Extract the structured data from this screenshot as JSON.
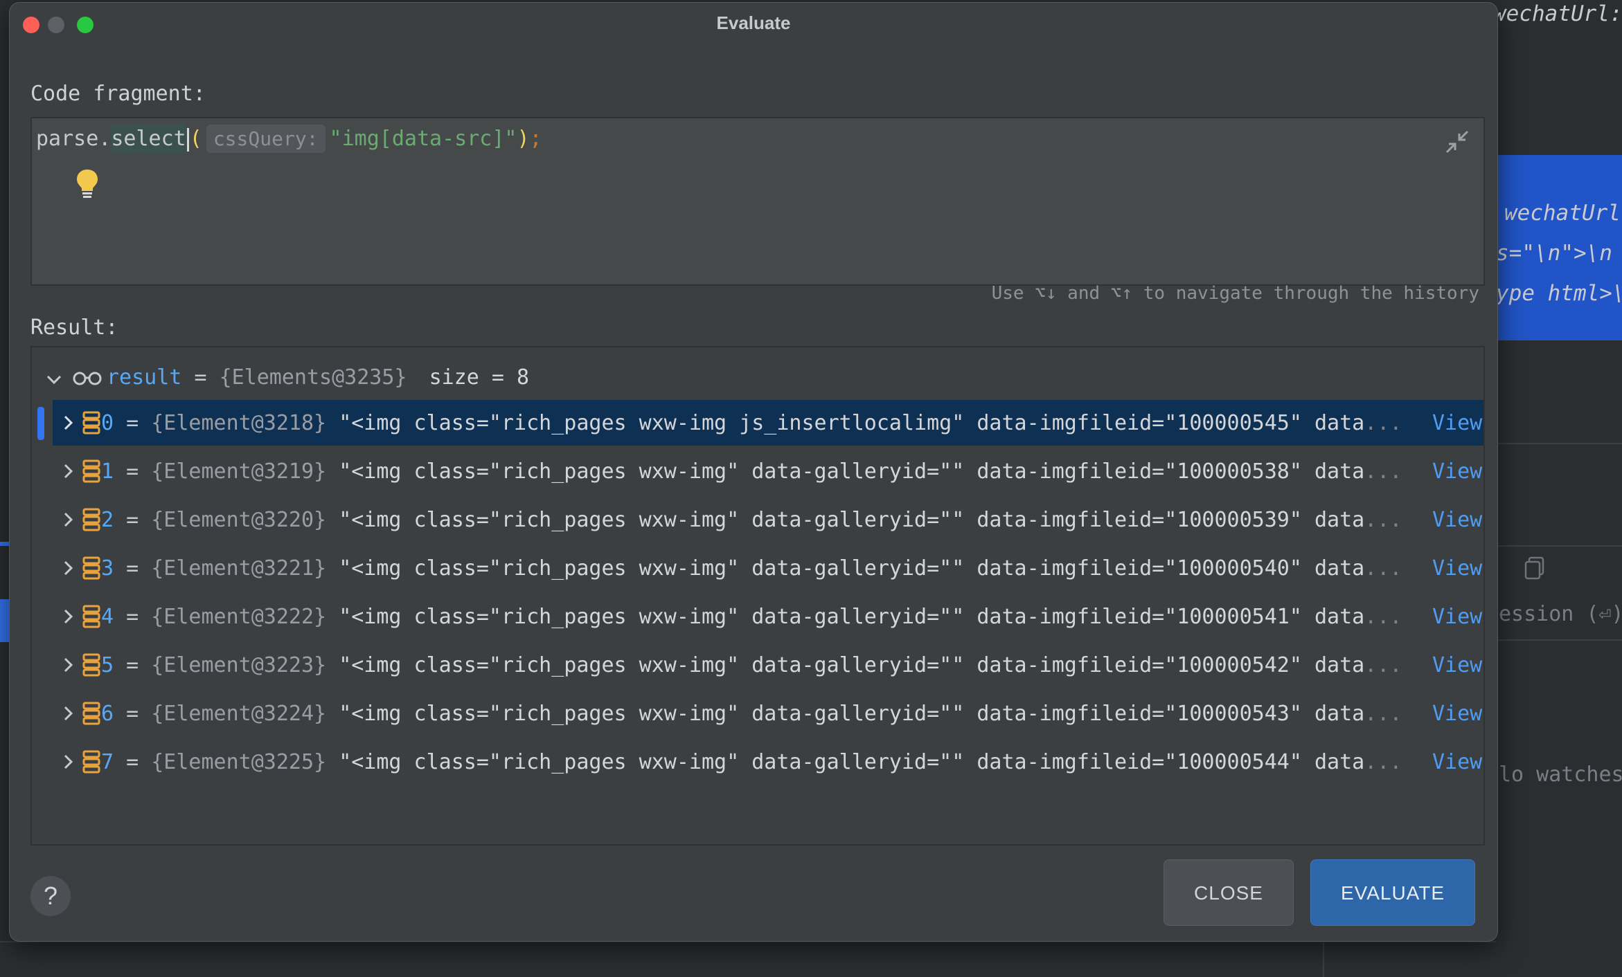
{
  "background": {
    "right_lines": [
      "wechatUrl:",
      "wechatUrl",
      "s=\"\\n\">\\n",
      "ype html>\\"
    ],
    "session_label": "ession (⏎)",
    "watches_label": "lo watches"
  },
  "dialog": {
    "title": "Evaluate",
    "code_fragment_label": "Code fragment:",
    "code": {
      "receiver": "parse.",
      "method": "select",
      "open_paren": "(",
      "param_hint": "cssQuery:",
      "argument": "\"img[data-src]\"",
      "close_paren": ")",
      "semicolon": ";"
    },
    "history_hint": "Use ⌥↓ and ⌥↑ to navigate through the history",
    "result_label": "Result:",
    "result": {
      "name": "result",
      "ref": "{Elements@3235}",
      "size_text": "size = 8",
      "children": [
        {
          "index": "0",
          "ref": "{Element@3218}",
          "value": "\"<img class=\"rich_pages wxw-img js_insertlocalimg\" data-imgfileid=\"100000545\" data",
          "link": "View"
        },
        {
          "index": "1",
          "ref": "{Element@3219}",
          "value": "\"<img class=\"rich_pages wxw-img\" data-galleryid=\"\" data-imgfileid=\"100000538\" data",
          "link": "View"
        },
        {
          "index": "2",
          "ref": "{Element@3220}",
          "value": "\"<img class=\"rich_pages wxw-img\" data-galleryid=\"\" data-imgfileid=\"100000539\" data",
          "link": "View"
        },
        {
          "index": "3",
          "ref": "{Element@3221}",
          "value": "\"<img class=\"rich_pages wxw-img\" data-galleryid=\"\" data-imgfileid=\"100000540\" data",
          "link": "View"
        },
        {
          "index": "4",
          "ref": "{Element@3222}",
          "value": "\"<img class=\"rich_pages wxw-img\" data-galleryid=\"\" data-imgfileid=\"100000541\" data",
          "link": "View"
        },
        {
          "index": "5",
          "ref": "{Element@3223}",
          "value": "\"<img class=\"rich_pages wxw-img\" data-galleryid=\"\" data-imgfileid=\"100000542\" data",
          "link": "View"
        },
        {
          "index": "6",
          "ref": "{Element@3224}",
          "value": "\"<img class=\"rich_pages wxw-img\" data-galleryid=\"\" data-imgfileid=\"100000543\" data",
          "link": "View"
        },
        {
          "index": "7",
          "ref": "{Element@3225}",
          "value": "\"<img class=\"rich_pages wxw-img\" data-galleryid=\"\" data-imgfileid=\"100000544\" data",
          "link": "View"
        }
      ]
    },
    "ellipsis": "...",
    "equals": "=",
    "help_label": "?",
    "close_button": "CLOSE",
    "evaluate_button": "EVALUATE"
  },
  "icons": {
    "lightbulb": "lightbulb-icon",
    "collapse": "collapse-arrows-icon",
    "expand": "chevron-right-icon",
    "collapse_tree": "chevron-down-icon",
    "watch": "glasses-icon",
    "element": "stack-icon"
  },
  "colors": {
    "selection": "#0e3153",
    "accent": "#3574f0",
    "evaluate_button": "#2d66a9",
    "string": "#6aab73",
    "index": "#57a8f5",
    "element_icon": "#e8a33d"
  }
}
